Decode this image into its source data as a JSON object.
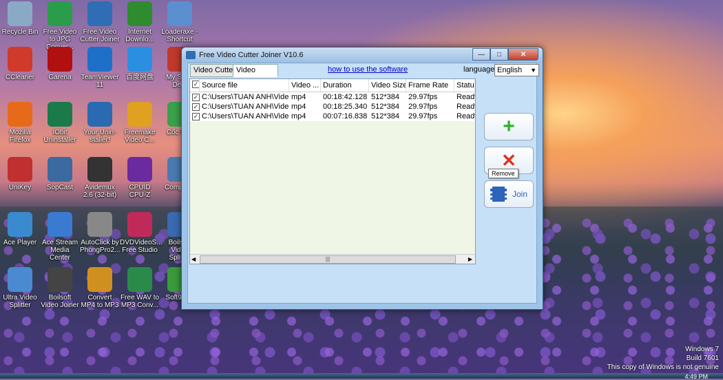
{
  "desktop": {
    "icons": [
      {
        "label": "Recycle Bin",
        "icon": "recycle-bin-icon",
        "color": "#8aa9c4"
      },
      {
        "label": "Free Video to JPG Conver...",
        "icon": "jpg-converter-icon",
        "color": "#2a9c4a"
      },
      {
        "label": "Free Video Cutter Joiner",
        "icon": "video-cutter-icon",
        "color": "#2f6db5"
      },
      {
        "label": "Internet Downlo...",
        "icon": "idm-icon",
        "color": "#2e8b2e"
      },
      {
        "label": "Loaderaxe - Shortcut",
        "icon": "loader-icon",
        "color": "#5b8fd0"
      },
      {
        "label": "CCleaner",
        "icon": "ccleaner-icon",
        "color": "#d03a2a"
      },
      {
        "label": "Garena",
        "icon": "garena-icon",
        "color": "#b01010"
      },
      {
        "label": "TeamViewer 11",
        "icon": "teamviewer-icon",
        "color": "#1e6fc8"
      },
      {
        "label": "百度网盘",
        "icon": "baidu-icon",
        "color": "#2a8fe0"
      },
      {
        "label": "My Sof... De...",
        "icon": "software-icon",
        "color": "#c0392b"
      },
      {
        "label": "Mozilla Firefox",
        "icon": "firefox-icon",
        "color": "#e66a1a"
      },
      {
        "label": "IObit Uninstaller",
        "icon": "iobit-icon",
        "color": "#1a7a4a"
      },
      {
        "label": "Your Unin-staller!",
        "icon": "uninstaller-icon",
        "color": "#2a6ab0"
      },
      {
        "label": "Freemake Video C...",
        "icon": "freemake-icon",
        "color": "#e0a020"
      },
      {
        "label": "Cốc Cốc",
        "icon": "coccoc-icon",
        "color": "#3aa04a"
      },
      {
        "label": "UniKey",
        "icon": "unikey-icon",
        "color": "#c03030"
      },
      {
        "label": "SopCast",
        "icon": "sopcast-icon",
        "color": "#3a6aa0"
      },
      {
        "label": "Avidemux 2.6 (32-bit)",
        "icon": "avidemux-icon",
        "color": "#333333"
      },
      {
        "label": "CPUID CPU-Z",
        "icon": "cpuz-icon",
        "color": "#6a2aa0"
      },
      {
        "label": "Computer",
        "icon": "computer-icon",
        "color": "#4a7ab0"
      },
      {
        "label": "Ace Player",
        "icon": "ace-player-icon",
        "color": "#3a8ad0"
      },
      {
        "label": "Ace Stream Media Center",
        "icon": "ace-stream-icon",
        "color": "#3a7ad0"
      },
      {
        "label": "AutoClick by PhongPro2...",
        "icon": "autoclick-icon",
        "color": "#888888"
      },
      {
        "label": "DVDVideoS... Free Studio",
        "icon": "dvdvideosoft-icon",
        "color": "#c02a5a"
      },
      {
        "label": "Boilsoft Video Splitter",
        "icon": "boilsoft-splitter-icon",
        "color": "#3a6ab0"
      },
      {
        "label": "Ultra Video Splitter",
        "icon": "ultra-splitter-icon",
        "color": "#4a8ad0"
      },
      {
        "label": "Boilsoft Video Joiner",
        "icon": "boilsoft-joiner-icon",
        "color": "#444444"
      },
      {
        "label": "Convert MP4 to MP3",
        "icon": "mp4-to-mp3-icon",
        "color": "#d09020"
      },
      {
        "label": "Free WAV to MP3 Conv...",
        "icon": "wav-to-mp3-icon",
        "color": "#2a8a4a"
      },
      {
        "label": "Soft98.iR",
        "icon": "soft98-icon",
        "color": "#3a9a3a"
      }
    ]
  },
  "window": {
    "title": "Free Video Cutter Joiner V10.6",
    "tabs": [
      "Video Cutter",
      "Video Joiner"
    ],
    "active_tab": "Video Joiner",
    "help_link": "how to use the software",
    "language_label": "language",
    "language_value": "English",
    "table": {
      "headers": [
        "Source file",
        "Video ...",
        "Duration",
        "Video Size",
        "Frame Rate",
        "Status"
      ],
      "rows": [
        [
          "C:\\Users\\TUAN ANH\\Video...",
          "mp4",
          "00:18:42.128",
          "512*384",
          "29.97fps",
          "Ready"
        ],
        [
          "C:\\Users\\TUAN ANH\\Video...",
          "mp4",
          "00:18:25.340",
          "512*384",
          "29.97fps",
          "Ready"
        ],
        [
          "C:\\Users\\TUAN ANH\\Video...",
          "mp4",
          "00:07:16.838",
          "512*384",
          "29.97fps",
          "Ready"
        ]
      ]
    },
    "buttons": {
      "add_icon": "+",
      "remove_icon": "✕",
      "remove_tooltip": "Remove",
      "join_label": "Join"
    }
  },
  "os": {
    "watermark_line1": "Windows 7",
    "watermark_line2": "Build 7601",
    "watermark_line3": "This copy of Windows is not genuine",
    "clock": "4:49 PM"
  }
}
